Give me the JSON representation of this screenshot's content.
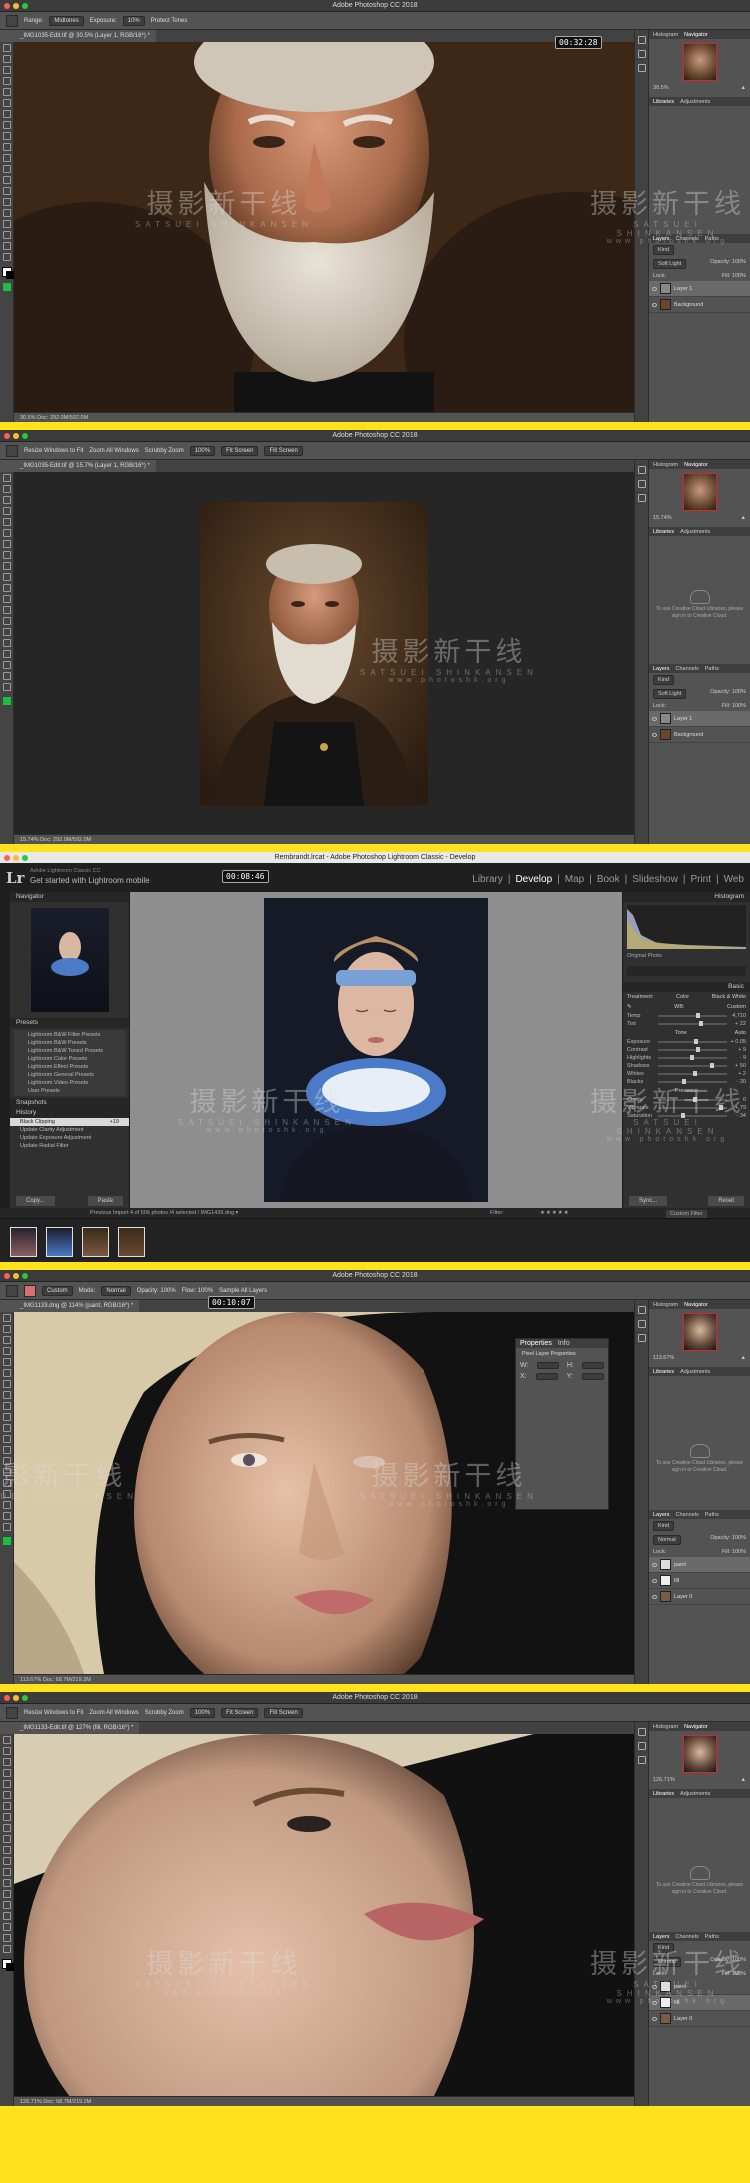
{
  "watermark": {
    "zh": "摄影新干线",
    "en": "SATSUEI SHINKANSEN",
    "url": "www.photoshk.org"
  },
  "frame1": {
    "app_title": "Adobe Photoshop CC 2018",
    "options": {
      "range_label": "Range:",
      "range_value": "Midtones",
      "exposure_label": "Exposure:",
      "exposure_value": "10%",
      "protect_tones": "Protect Tones"
    },
    "tab": "_IMG1035-Edit.tif @ 30.5% (Layer 1, RGB/16*) *",
    "timer": "00:32:28",
    "status": "30.5%        Doc: 292.0M/592.0M",
    "panels": {
      "tabs": [
        "Histogram",
        "Navigator"
      ],
      "zoom": "30.5%",
      "libraries_tabs": [
        "Libraries",
        "Adjustments"
      ],
      "layers_tabs": [
        "Layers",
        "Channels",
        "Paths"
      ],
      "kind": "Kind",
      "blend_mode": "Soft Light",
      "opacity": "Opacity: 100%",
      "fill": "Fill: 100%",
      "lock": "Lock:",
      "layers": [
        "Layer 1",
        "Background"
      ]
    }
  },
  "frame2": {
    "app_title": "Adobe Photoshop CC 2018",
    "options": {
      "resize": "Resize Windows to Fit",
      "zoom_all": "Zoom All Windows",
      "scrubby": "Scrubby Zoom",
      "pct": "100%",
      "fit": "Fit Screen",
      "fill": "Fill Screen"
    },
    "tab": "_IMG1035-Edit.tif @ 15.7% (Layer 1, RGB/16*) *",
    "status": "15.74%       Doc: 292.0M/592.0M",
    "panels": {
      "tabs": [
        "Histogram",
        "Navigator"
      ],
      "zoom": "15.74%",
      "libraries_tabs": [
        "Libraries",
        "Adjustments"
      ],
      "cc_text": "To use Creative Cloud Libraries, please sign in to Creative Cloud.",
      "layers_tabs": [
        "Layers",
        "Channels",
        "Paths"
      ],
      "kind": "Kind",
      "blend_mode": "Soft Light",
      "opacity": "Opacity: 100%",
      "fill": "Fill: 100%",
      "lock": "Lock:",
      "layers": [
        "Layer 1",
        "Background"
      ]
    }
  },
  "frame3": {
    "window_title": "Rembrandt.lrcat - Adobe Photoshop Lightroom Classic - Develop",
    "lr_sub1": "Adobe Lightroom Classic CC",
    "lr_sub2": "Get started with Lightroom mobile",
    "timer": "00:08:46",
    "modules": [
      "Library",
      "Develop",
      "Map",
      "Book",
      "Slideshow",
      "Print",
      "Web"
    ],
    "navigator": "Navigator",
    "presets_header": "Presets",
    "presets": [
      "Lightroom B&W Filter Presets",
      "Lightroom B&W Presets",
      "Lightroom B&W Toned Presets",
      "Lightroom Color Presets",
      "Lightroom Effect Presets",
      "Lightroom General Presets",
      "Lightroom Video Presets",
      "User Presets"
    ],
    "snapshots": "Snapshots",
    "history": "History",
    "history_items": [
      "Black Clipping",
      "Update Clarity Adjustment",
      "Update Exposure Adjustment",
      "Update Radial Filter"
    ],
    "history_value": "+19",
    "copy": "Copy...",
    "paste": "Paste",
    "histogram": "Histogram",
    "original_photo": "Original Photo",
    "basic": "Basic",
    "treatment": "Treatment:",
    "color": "Color",
    "bw": "Black & White",
    "wb": "WB:",
    "wb_value": "Custom",
    "sliders": [
      {
        "label": "Temp",
        "value": "4,710",
        "pos": 0.55
      },
      {
        "label": "Tint",
        "value": "+ 22",
        "pos": 0.6
      },
      {
        "label": "Exposure",
        "value": "+ 0.05",
        "pos": 0.52
      },
      {
        "label": "Contrast",
        "value": "+ 9",
        "pos": 0.55
      },
      {
        "label": "Highlights",
        "value": "- 9",
        "pos": 0.46
      },
      {
        "label": "Shadows",
        "value": "+ 50",
        "pos": 0.75
      },
      {
        "label": "Whites",
        "value": "+ 2",
        "pos": 0.51
      },
      {
        "label": "Blacks",
        "value": "- 30",
        "pos": 0.35
      },
      {
        "label": "Clarity",
        "value": "0",
        "pos": 0.5
      },
      {
        "label": "Vibrance",
        "value": "+ 79",
        "pos": 0.88
      },
      {
        "label": "Saturation",
        "value": "- 34",
        "pos": 0.33
      }
    ],
    "tone_label": "Tone",
    "auto": "Auto",
    "presence": "Presence",
    "sync": "Sync...",
    "reset": "Reset",
    "filmstrip_info": "Previous Import     4 of 506 photos /4 selected / IMG1439.dng ▾",
    "filter": "Filter:",
    "custom_filter": "Custom Filter"
  },
  "frame4": {
    "app_title": "Adobe Photoshop CC 2018",
    "options": {
      "mode": "Custom",
      "mode_label": "Mode:",
      "mode_value": "Normal",
      "opacity": "Opacity: 100%",
      "flow": "Flow: 100%",
      "sample": "Sample All Layers"
    },
    "tab": "_IMG1133.dng @ 114% (paint, RGB/16*) *",
    "timer": "00:10:07",
    "status": "113.67%      Doc: 68.7M/219.2M",
    "properties": {
      "tabs": [
        "Properties",
        "Info"
      ],
      "title": "Pixel Layer Properties",
      "w": "W:",
      "h": "H:",
      "x": "X:",
      "y": "Y:"
    },
    "panels": {
      "tabs": [
        "Histogram",
        "Navigator"
      ],
      "zoom": "113.67%",
      "libraries_tabs": [
        "Libraries",
        "Adjustments"
      ],
      "cc_text": "To use Creative Cloud Libraries, please sign in to Creative Cloud.",
      "layers_tabs": [
        "Layers",
        "Channels",
        "Paths"
      ],
      "kind": "Kind",
      "blend_mode": "Normal",
      "opacity": "Opacity: 100%",
      "fill": "Fill: 100%",
      "lock": "Lock:",
      "layers": [
        "paint",
        "fill",
        "Layer 0"
      ]
    }
  },
  "frame5": {
    "app_title": "Adobe Photoshop CC 2018",
    "options": {
      "resize": "Resize Windows to Fit",
      "zoom_all": "Zoom All Windows",
      "scrubby": "Scrubby Zoom",
      "pct": "100%",
      "fit": "Fit Screen",
      "fill": "Fill Screen"
    },
    "tab": "_IMG1133-Edit.tif @ 127% (fill, RGB/16*) *",
    "status": "126.71%      Doc: 68.7M/219.2M",
    "panels": {
      "tabs": [
        "Histogram",
        "Navigator"
      ],
      "zoom": "126.71%",
      "libraries_tabs": [
        "Libraries",
        "Adjustments"
      ],
      "cc_text": "To use Creative Cloud Libraries, please sign in to Creative Cloud.",
      "layers_tabs": [
        "Layers",
        "Channels",
        "Paths"
      ],
      "kind": "Kind",
      "blend_mode": "Normal",
      "opacity": "Opacity: 100%",
      "fill": "Fill: 100%",
      "lock": "Lock:",
      "layers": [
        "paint",
        "fill",
        "Layer 0"
      ]
    }
  }
}
